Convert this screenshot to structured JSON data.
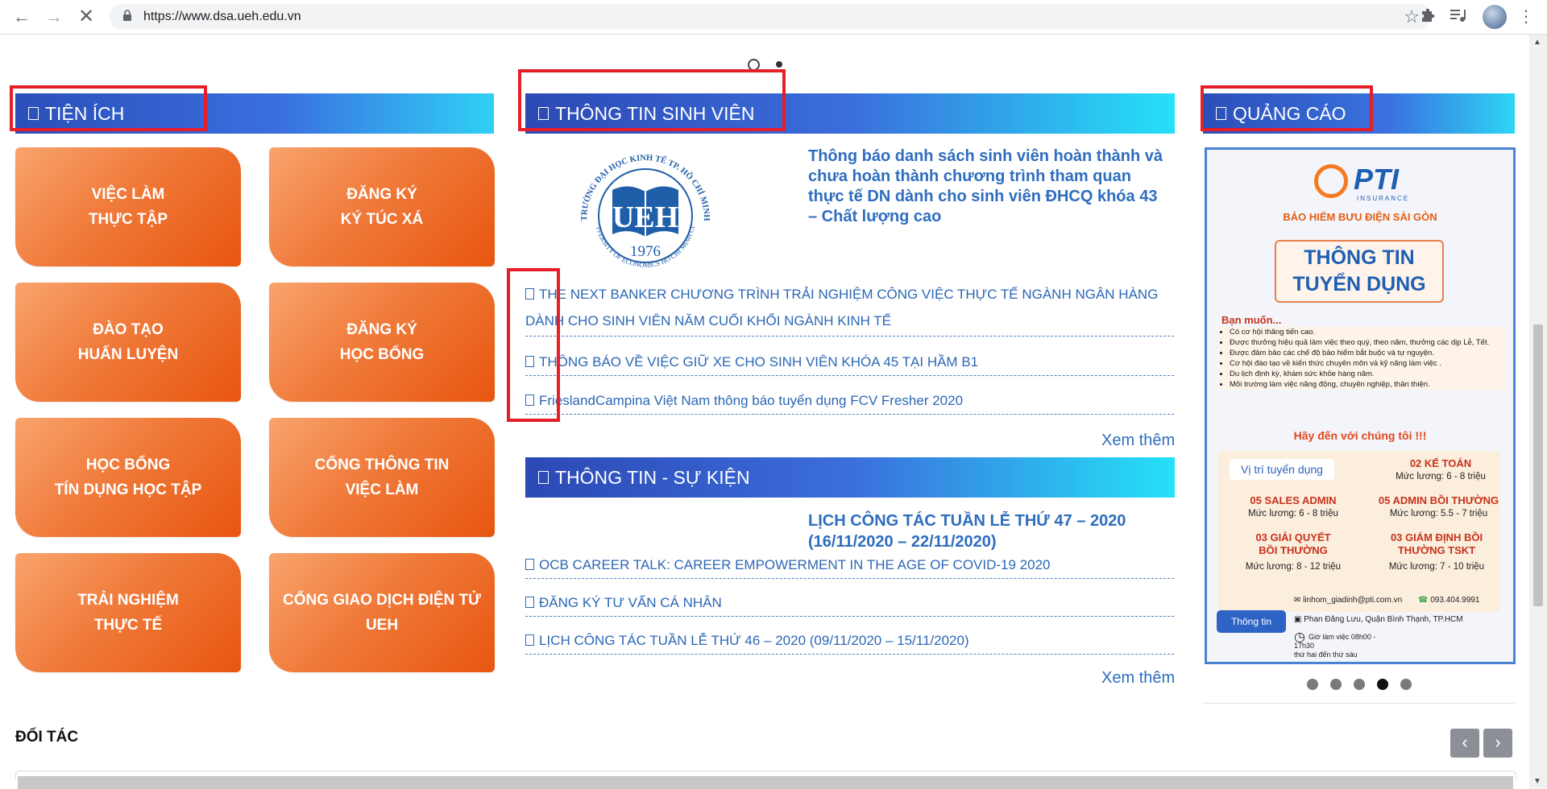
{
  "browser": {
    "url": "https://www.dsa.ueh.edu.vn",
    "icons": [
      "back-icon",
      "forward-icon",
      "stop-icon",
      "lock-icon",
      "bookmark-star-icon",
      "extensions-icon",
      "media-icon",
      "profile-avatar",
      "menu-icon"
    ]
  },
  "utilities": {
    "title": "TIỆN ÍCH",
    "tiles": [
      {
        "line1": "VIỆC LÀM",
        "line2": "THỰC TẬP"
      },
      {
        "line1": "ĐĂNG KÝ",
        "line2": "KÝ TÚC XÁ"
      },
      {
        "line1": "ĐÀO TẠO",
        "line2": "HUẤN LUYỆN"
      },
      {
        "line1": "ĐĂNG KÝ",
        "line2": "HỌC BỔNG"
      },
      {
        "line1": "HỌC BỔNG",
        "line2": "TÍN DỤNG HỌC TẬP"
      },
      {
        "line1": "CỔNG THÔNG TIN",
        "line2": "VIỆC LÀM"
      },
      {
        "line1": "TRẢI NGHIỆM",
        "line2": "THỰC TẾ"
      },
      {
        "line1": "CỔNG GIAO DỊCH ĐIỆN TỬ",
        "line2": "UEH"
      }
    ]
  },
  "student_info": {
    "title": "THÔNG TIN SINH VIÊN",
    "featured": "Thông báo danh sách sinh viên hoàn thành và chưa hoàn thành chương trình tham quan thực tế DN dành cho sinh viên ĐHCQ khóa 43 – Chất lượng cao",
    "logo": {
      "arc_text": "TRƯỜNG ĐẠI HỌC KINH TẾ TP. HỒ CHÍ MINH",
      "letters": "UEH",
      "year": "1976",
      "bottom_text": "UNIVERSITY OF ECONOMICS HO CHI MINH CITY"
    },
    "links": [
      "THE NEXT BANKER CHƯƠNG TRÌNH TRẢI NGHIỆM CÔNG VIỆC THỰC TẾ NGÀNH NGÂN HÀNG DÀNH CHO SINH VIÊN NĂM CUỐI KHỐI NGÀNH KINH TẾ",
      "THÔNG BÁO VỀ VIỆC GIỮ XE CHO SINH VIÊN KHÓA 45 TẠI HẦM B1",
      "FrieslandCampina Việt Nam thông báo tuyển dụng FCV Fresher 2020"
    ],
    "more": "Xem thêm"
  },
  "events": {
    "title": "THÔNG TIN - SỰ KIỆN",
    "featured": "LỊCH CÔNG TÁC TUẦN LỄ THỨ 47 – 2020 (16/11/2020 – 22/11/2020)",
    "links": [
      "OCB CAREER TALK: CAREER EMPOWERMENT IN THE AGE OF COVID-19 2020",
      "ĐĂNG KÝ TƯ VẤN CÁ NHÂN",
      "LỊCH CÔNG TÁC TUẦN LỄ THỨ 46 – 2020 (09/11/2020 – 15/11/2020)"
    ],
    "more": "Xem thêm"
  },
  "ads": {
    "title": "QUẢNG CÁO",
    "brand": "PTI",
    "brand_sub": "INSURANCE",
    "company": "BẢO HIỂM BƯU ĐIỆN SÀI GÒN",
    "headline_1": "THÔNG TIN",
    "headline_2": "TUYỂN DỤNG",
    "want_title": "Bạn muốn...",
    "benefits": [
      "Có cơ hội thăng tiến cao.",
      "Được thưởng hiệu quả làm việc theo quý, theo năm, thưởng các dịp Lễ, Tết.",
      "Được đảm bảo các chế độ bảo hiểm bắt buộc và tự nguyện.",
      "Cơ hội đào tạo về kiến thức chuyên môn và kỹ năng làm việc .",
      "Du lịch định kỳ, khám sức khỏe hàng năm.",
      "Môi trường làm việc năng động, chuyên nghiệp, thân thiện."
    ],
    "call": "Hãy đến với chúng tôi !!!",
    "positions_label": "Vị trí tuyển dụng",
    "positions": [
      {
        "name": "02 KẾ TOÁN",
        "salary": "Mức lương: 6 - 8 triệu"
      },
      {
        "name": "05 SALES ADMIN",
        "salary": "Mức lương: 6 - 8 triệu"
      },
      {
        "name": "05 ADMIN BỒI THƯỜNG",
        "salary": "Mức lương: 5.5 - 7 triệu"
      },
      {
        "name": "03 GIẢI QUYẾT BỒI THƯỜNG",
        "salary": "Mức lương: 8 - 12 triệu"
      },
      {
        "name": "03 GIÁM ĐỊNH BỒI THƯỜNG TSKT",
        "salary": "Mức lương: 7 - 10 triệu"
      }
    ],
    "contact_label": "Thông tin",
    "email": "linhom_giadinh@pti.com.vn",
    "phone": "093.404.9991",
    "address": "Phan Đăng Lưu, Quận Bình Thạnh, TP.HCM",
    "hours_1": "Giờ làm việc 08h00 - 17h30",
    "hours_2": "thứ hai đến thứ sáu",
    "carousel_dots": 5,
    "active_dot": 4
  },
  "partners": {
    "title": "ĐỐI TÁC",
    "prev": "‹",
    "next": "›"
  },
  "colors": {
    "highlight": "#e61e2a",
    "tile_orange": "#f07a3a",
    "link_blue": "#2b67b5"
  }
}
